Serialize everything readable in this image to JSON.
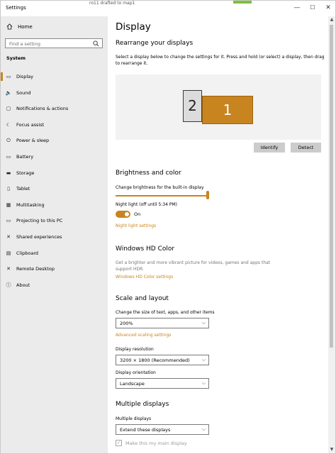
{
  "window": {
    "title": "Settings",
    "background_text": "ro11 drafted to map1",
    "min": "—",
    "max": "☐",
    "close": "✕"
  },
  "sidebar": {
    "home": "Home",
    "search_placeholder": "Find a setting",
    "section": "System",
    "items": [
      {
        "label": "Display",
        "icon": "display-icon",
        "glyph": "▭"
      },
      {
        "label": "Sound",
        "icon": "sound-icon",
        "glyph": "🔈"
      },
      {
        "label": "Notifications & actions",
        "icon": "notifications-icon",
        "glyph": "▢"
      },
      {
        "label": "Focus assist",
        "icon": "focus-assist-icon",
        "glyph": "☾"
      },
      {
        "label": "Power & sleep",
        "icon": "power-icon",
        "glyph": "⏻"
      },
      {
        "label": "Battery",
        "icon": "battery-icon",
        "glyph": "▭"
      },
      {
        "label": "Storage",
        "icon": "storage-icon",
        "glyph": "▬"
      },
      {
        "label": "Tablet",
        "icon": "tablet-icon",
        "glyph": "▯"
      },
      {
        "label": "Multitasking",
        "icon": "multitasking-icon",
        "glyph": "▦"
      },
      {
        "label": "Projecting to this PC",
        "icon": "projecting-icon",
        "glyph": "▭"
      },
      {
        "label": "Shared experiences",
        "icon": "shared-experiences-icon",
        "glyph": "✕"
      },
      {
        "label": "Clipboard",
        "icon": "clipboard-icon",
        "glyph": "▤"
      },
      {
        "label": "Remote Desktop",
        "icon": "remote-desktop-icon",
        "glyph": "✕"
      },
      {
        "label": "About",
        "icon": "info-icon",
        "glyph": "ⓘ"
      }
    ]
  },
  "content": {
    "title": "Display",
    "rearrange": {
      "heading": "Rearrange your displays",
      "description": "Select a display below to change the settings for it. Press and hold (or select) a display, then drag to rearrange it.",
      "display_1": "1",
      "display_2": "2",
      "identify": "Identify",
      "detect": "Detect"
    },
    "brightness": {
      "heading": "Brightness and color",
      "slider_label": "Change brightness for the built-in display",
      "brightness_level": 1.0,
      "night_light_label": "Night light (off until 5:34 PM)",
      "toggle_state": "On",
      "night_light_settings": "Night light settings"
    },
    "hdr": {
      "heading": "Windows HD Color",
      "description": "Get a brighter and more vibrant picture for videos, games and apps that support HDR.",
      "link": "Windows HD Color settings"
    },
    "scale": {
      "heading": "Scale and layout",
      "size_label": "Change the size of text, apps, and other items",
      "size_value": "200%",
      "advanced_link": "Advanced scaling settings",
      "resolution_label": "Display resolution",
      "resolution_value": "3200 × 1800 (Recommended)",
      "orientation_label": "Display orientation",
      "orientation_value": "Landscape"
    },
    "multiple": {
      "heading": "Multiple displays",
      "label": "Multiple displays",
      "value": "Extend these displays",
      "main_display_label": "Make this my main display"
    }
  },
  "colors": {
    "accent": "#c8841e",
    "sidebar_bg": "#ebebeb",
    "button_bg": "#cccccc"
  }
}
